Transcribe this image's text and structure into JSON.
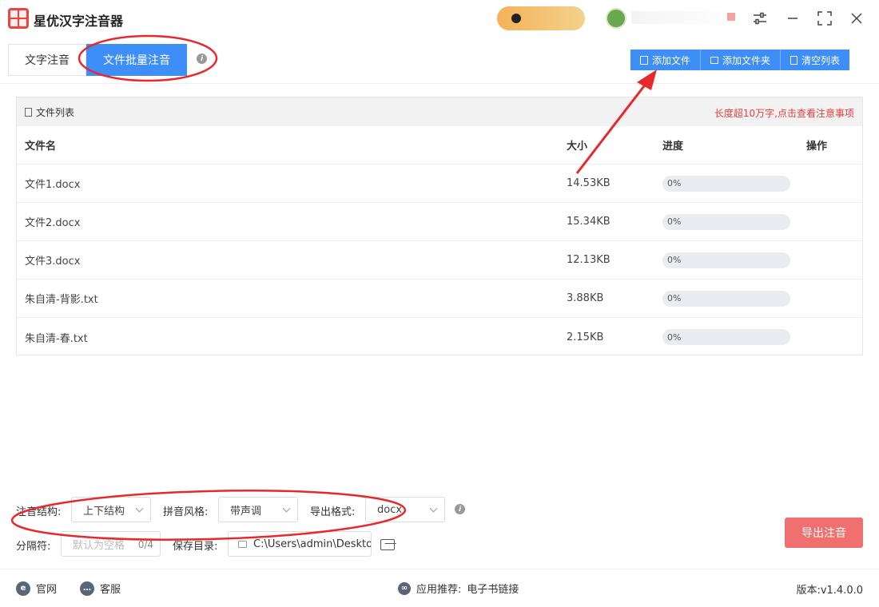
{
  "app": {
    "title": "星优汉字注音器"
  },
  "tabs": [
    {
      "label": "文字注音",
      "active": false
    },
    {
      "label": "文件批量注音",
      "active": true
    }
  ],
  "toolbar": {
    "add_file": "添加文件",
    "add_folder": "添加文件夹",
    "clear_list": "清空列表"
  },
  "file_list": {
    "title": "文件列表",
    "warning": "长度超10万字,点击查看注意事项",
    "columns": {
      "name": "文件名",
      "size": "大小",
      "progress": "进度",
      "action": "操作"
    },
    "rows": [
      {
        "name": "文件1.docx",
        "size": "14.53KB",
        "progress": "0%",
        "progress_value": 0
      },
      {
        "name": "文件2.docx",
        "size": "15.34KB",
        "progress": "0%",
        "progress_value": 0
      },
      {
        "name": "文件3.docx",
        "size": "12.13KB",
        "progress": "0%",
        "progress_value": 0
      },
      {
        "name": "朱自清-背影.txt",
        "size": "3.88KB",
        "progress": "0%",
        "progress_value": 0
      },
      {
        "name": "朱自清-春.txt",
        "size": "2.15KB",
        "progress": "0%",
        "progress_value": 0
      }
    ]
  },
  "settings": {
    "structure_label": "注音结构:",
    "structure_value": "上下结构",
    "style_label": "拼音风格:",
    "style_value": "带声调",
    "format_label": "导出格式:",
    "format_value": "docx",
    "separator_label": "分隔符:",
    "separator_placeholder": "默认为空格",
    "separator_count": "0/4",
    "save_dir_label": "保存目录:",
    "save_dir_value": "C:\\Users\\admin\\Deskto"
  },
  "export_button": "导出注音",
  "footer": {
    "website": "官网",
    "support": "客服",
    "recommend_label": "应用推荐:",
    "recommend_link": "电子书链接",
    "version": "版本:v1.4.0.0"
  },
  "colors": {
    "accent": "#3d8ff7",
    "export": "#f07070",
    "warning": "#e04040",
    "annotation": "#e8282b"
  }
}
